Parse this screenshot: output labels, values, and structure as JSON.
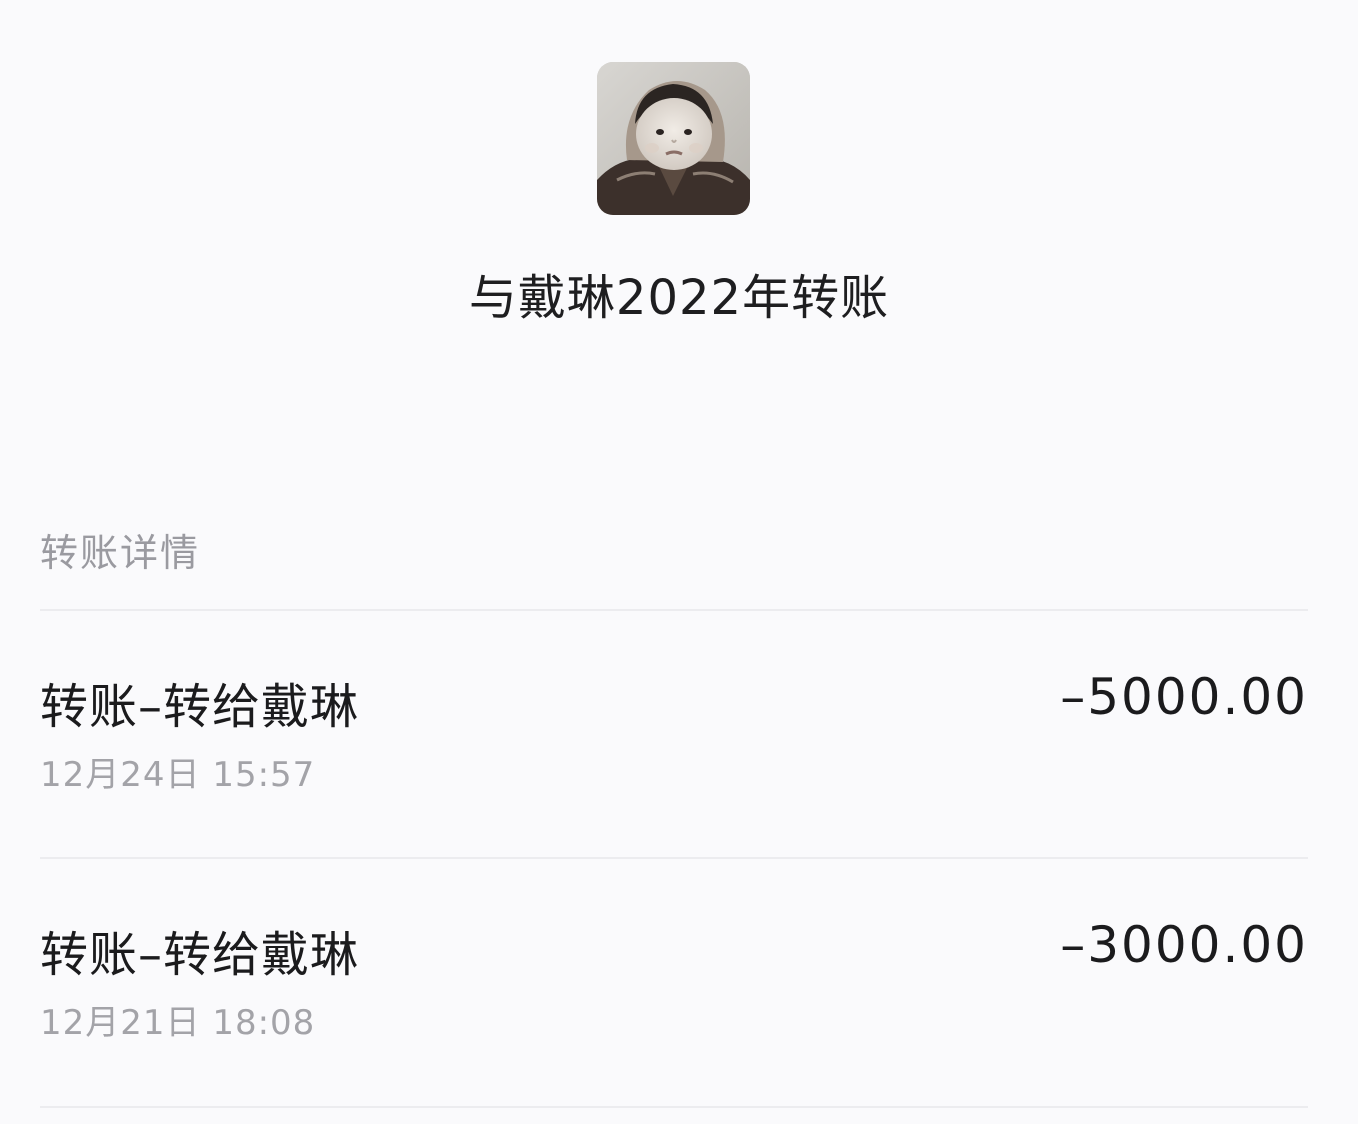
{
  "header": {
    "avatar_icon": "child-portrait-avatar",
    "title": "与戴琳2022年转账"
  },
  "section": {
    "title": "转账详情"
  },
  "transactions": [
    {
      "title": "转账–转给戴琳",
      "amount": "–5000.00",
      "time": "12月24日 15:57"
    },
    {
      "title": "转账–转给戴琳",
      "amount": "–3000.00",
      "time": "12月21日 18:08"
    }
  ]
}
